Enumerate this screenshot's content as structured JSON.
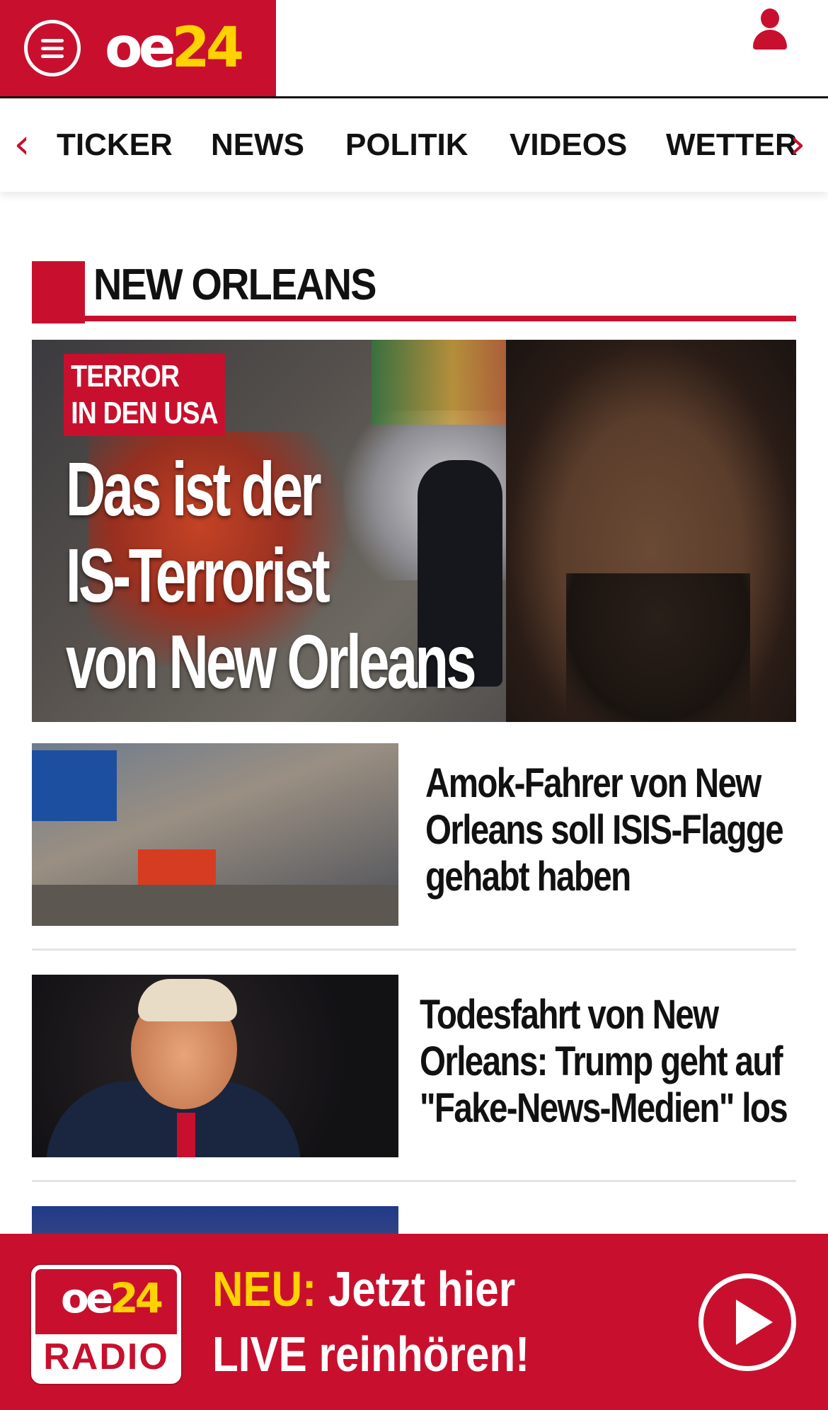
{
  "header": {
    "logo": {
      "part1": "oe",
      "part2": "24"
    },
    "menu_icon": "hamburger-icon",
    "user_icon": "user-icon"
  },
  "nav": {
    "items": [
      "TICKER",
      "NEWS",
      "POLITIK",
      "VIDEOS",
      "WETTER"
    ],
    "prev_icon": "chevron-left-icon",
    "next_icon": "chevron-right-icon"
  },
  "section": {
    "title": "NEW ORLEANS"
  },
  "hero": {
    "kicker_line1": "TERROR",
    "kicker_line2": "IN DEN USA",
    "title_line1": "Das ist der",
    "title_line2": "IS-Terrorist",
    "title_line3": "von New Orleans"
  },
  "articles": [
    {
      "headline_lines": [
        "Amok-Fahrer von New",
        "Orleans soll ISIS-Flagge",
        "gehabt haben"
      ]
    },
    {
      "headline_lines": [
        "Todesfahrt von New",
        "Orleans: Trump geht auf",
        "\"Fake-News-Medien\" los"
      ]
    }
  ],
  "radio_banner": {
    "logo_top_part1": "oe",
    "logo_top_part2": "24",
    "logo_bottom": "RADIO",
    "neu": "NEU:",
    "line1_rest": " Jetzt hier",
    "line2": "LIVE reinhören!",
    "play_icon": "play-icon"
  },
  "colors": {
    "brand_red": "#c8102e",
    "brand_yellow": "#ffd200"
  }
}
